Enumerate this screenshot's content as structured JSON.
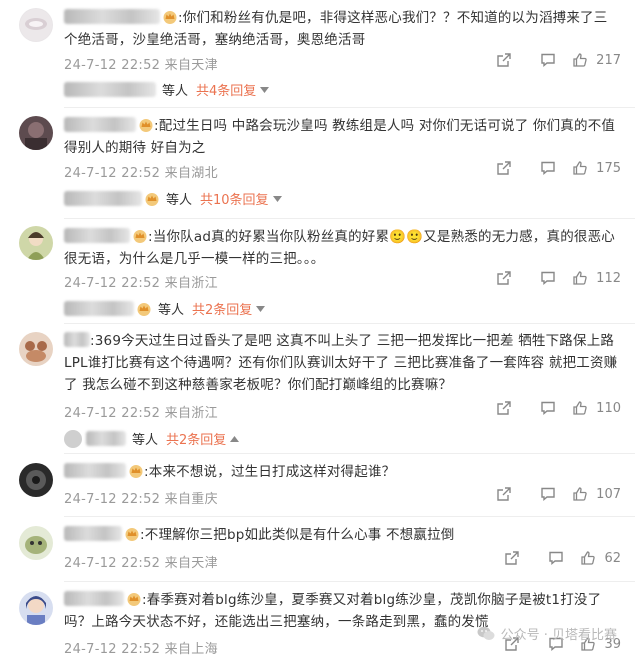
{
  "comments": [
    {
      "text": ":你们和粉丝有仇是吧，非得这样恶心我们？？不知道的以为滔搏来了三个绝活哥，沙皇绝活哥，塞纳绝活哥，奥恩绝活哥",
      "time": "24-7-12 22:52",
      "location": "来自天津",
      "likes": "217",
      "reply_prefix": "等人",
      "reply_count": "共4条回复",
      "reply_arrow": "down"
    },
    {
      "text": ":配过生日吗 中路会玩沙皇吗 教练组是人吗 对你们无话可说了 你们真的不值得别人的期待 好自为之",
      "time": "24-7-12 22:52",
      "location": "来自湖北",
      "likes": "175",
      "reply_prefix": "等人",
      "reply_count": "共10条回复",
      "reply_arrow": "down"
    },
    {
      "text": ":当你队ad真的好累当你队粉丝真的好累🙂🙂又是熟悉的无力感，真的很恶心很无语，为什么是几乎一模一样的三把。。。",
      "time": "24-7-12 22:52",
      "location": "来自浙江",
      "likes": "112",
      "reply_prefix": "等人",
      "reply_count": "共2条回复",
      "reply_arrow": "down"
    },
    {
      "text": ":369今天过生日过昏头了是吧 这真不叫上头了 三把一把发挥比一把差 牺牲下路保上路 LPL谁打比赛有这个待遇啊？还有你们队赛训太好干了 三把比赛准备了一套阵容 就把工资赚了 我怎么碰不到这种慈善家老板呢？你们配打巅峰组的比赛嘛？",
      "time": "24-7-12 22:52",
      "location": "来自浙江",
      "likes": "110",
      "reply_prefix": "等人",
      "reply_count": "共2条回复",
      "reply_arrow": "up"
    },
    {
      "text": ":本来不想说，过生日打成这样对得起谁？",
      "time": "24-7-12 22:52",
      "location": "来自重庆",
      "likes": "107"
    },
    {
      "text": ":不理解你三把bp如此类似是有什么心事 不想嬴拉倒",
      "time": "24-7-12 22:52",
      "location": "来自天津",
      "likes": "62"
    },
    {
      "text": ":春季赛对着blg练沙皇，夏季赛又对着blg练沙皇，茂凯你脑子是被t1打没了吗？上路今天状态不好，还能选出三把塞纳，一条路走到黑，蠢的发慌",
      "time": "24-7-12 22:52",
      "location": "来自上海",
      "likes": "39"
    }
  ],
  "watermark": "公众号 · 贝塔看比赛",
  "colors": {
    "accent": "#eb7350",
    "meta": "#9a9a9a",
    "text": "#333333"
  }
}
